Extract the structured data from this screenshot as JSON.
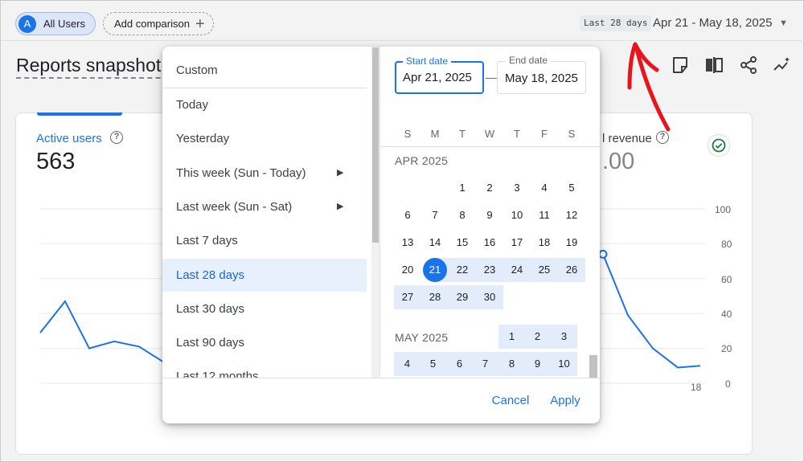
{
  "topbar": {
    "segment_avatar": "A",
    "segment_label": "All Users",
    "add_comparison_label": "Add comparison",
    "range_badge": "Last 28 days",
    "range_text": "Apr 21 - May 18, 2025"
  },
  "header": {
    "title": "Reports snapshot"
  },
  "card": {
    "metric_name": "Active users",
    "metric_value": "563",
    "metric2_name": "l revenue",
    "metric2_value": ".00",
    "right_axis_ticks": [
      "100",
      "80",
      "60",
      "40",
      "20",
      "0"
    ],
    "x_axis_tick": "18"
  },
  "chart_data": {
    "type": "line",
    "series": [
      {
        "values": [
          29,
          47,
          20,
          24,
          21,
          12
        ]
      },
      {
        "values": [
          74,
          39,
          20,
          9,
          10
        ]
      }
    ],
    "ylim": [
      0,
      100
    ],
    "xtick_labels_visible": [
      "18"
    ]
  },
  "date_picker": {
    "presets": [
      {
        "label": "Custom",
        "active": false,
        "submenu": false
      },
      {
        "label": "Today",
        "active": false,
        "submenu": false
      },
      {
        "label": "Yesterday",
        "active": false,
        "submenu": false
      },
      {
        "label": "This week (Sun - Today)",
        "active": false,
        "submenu": true
      },
      {
        "label": "Last week (Sun - Sat)",
        "active": false,
        "submenu": true
      },
      {
        "label": "Last 7 days",
        "active": false,
        "submenu": false
      },
      {
        "label": "Last 28 days",
        "active": true,
        "submenu": false
      },
      {
        "label": "Last 30 days",
        "active": false,
        "submenu": false
      },
      {
        "label": "Last 90 days",
        "active": false,
        "submenu": false
      },
      {
        "label": "Last 12 months",
        "active": false,
        "submenu": false
      }
    ],
    "start_label": "Start date",
    "start_value": "Apr 21, 2025",
    "end_label": "End date",
    "end_value": "May 18, 2025",
    "weekdays": [
      "S",
      "M",
      "T",
      "W",
      "T",
      "F",
      "S"
    ],
    "months": [
      {
        "label": "APR 2025",
        "start_weekday": 2,
        "days": 30,
        "highlight_from": 21,
        "highlight_to": 30,
        "selected": 21
      },
      {
        "label": "MAY 2025",
        "start_weekday": 4,
        "days_visible": 10,
        "highlight_from": 1,
        "highlight_to": 10
      }
    ],
    "cancel_label": "Cancel",
    "apply_label": "Apply"
  },
  "colors": {
    "accent": "#1a73e8",
    "range_highlight": "#e3ecfa",
    "annotation": "#e8141c"
  }
}
